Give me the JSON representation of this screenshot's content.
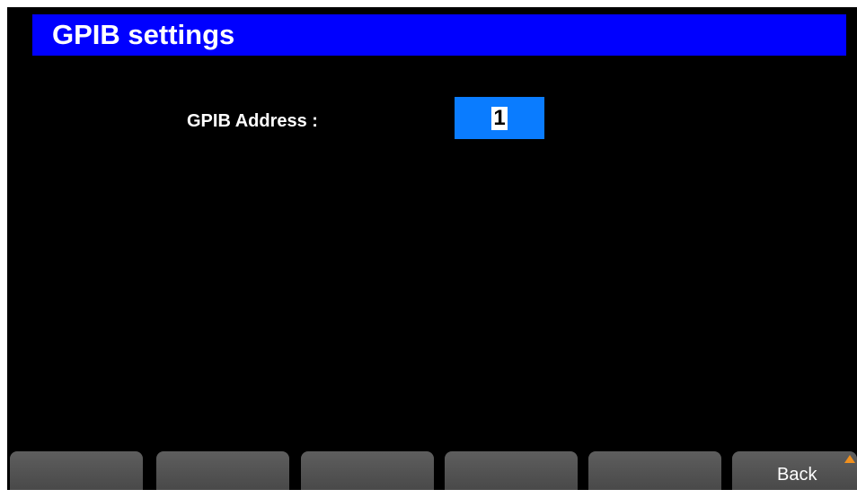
{
  "header": {
    "title": "GPIB settings"
  },
  "form": {
    "address_label": "GPIB Address :",
    "address_value": "1"
  },
  "softkeys": {
    "items": [
      {
        "label": ""
      },
      {
        "label": ""
      },
      {
        "label": ""
      },
      {
        "label": ""
      },
      {
        "label": ""
      },
      {
        "label": "Back"
      }
    ]
  },
  "colors": {
    "title_bar": "#0000ff",
    "input_highlight": "#0a7cff",
    "background": "#000000",
    "softkey": "#555555",
    "back_indicator": "#f0901e"
  },
  "icons": {
    "back": "up-arrow-icon"
  }
}
